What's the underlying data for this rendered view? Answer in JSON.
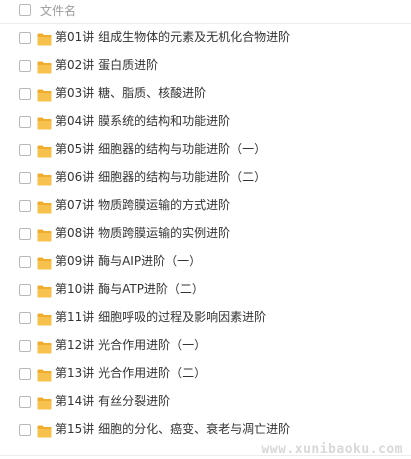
{
  "header": {
    "column_label": "文件名"
  },
  "icons": {
    "folder_color": "#f7c14d",
    "folder_tab_color": "#f0ad2d"
  },
  "files": [
    {
      "name": "第01讲 组成生物体的元素及无机化合物进阶"
    },
    {
      "name": "第02讲 蛋白质进阶"
    },
    {
      "name": "第03讲 糖、脂质、核酸进阶"
    },
    {
      "name": "第04讲 膜系统的结构和功能进阶"
    },
    {
      "name": "第05讲 细胞器的结构与功能进阶（一）"
    },
    {
      "name": "第06讲 细胞器的结构与功能进阶（二）"
    },
    {
      "name": "第07讲 物质跨膜运输的方式进阶"
    },
    {
      "name": "第08讲 物质跨膜运输的实例进阶"
    },
    {
      "name": "第09讲 酶与AIP进阶（一）"
    },
    {
      "name": "第10讲 酶与ATP进阶（二）"
    },
    {
      "name": "第11讲 细胞呼吸的过程及影响因素进阶"
    },
    {
      "name": "第12讲 光合作用进阶（一）"
    },
    {
      "name": "第13讲 光合作用进阶（二）"
    },
    {
      "name": "第14讲 有丝分裂进阶"
    },
    {
      "name": "第15讲 细胞的分化、癌变、衰老与凋亡进阶"
    }
  ],
  "watermark": "www.xunibaoku.com"
}
